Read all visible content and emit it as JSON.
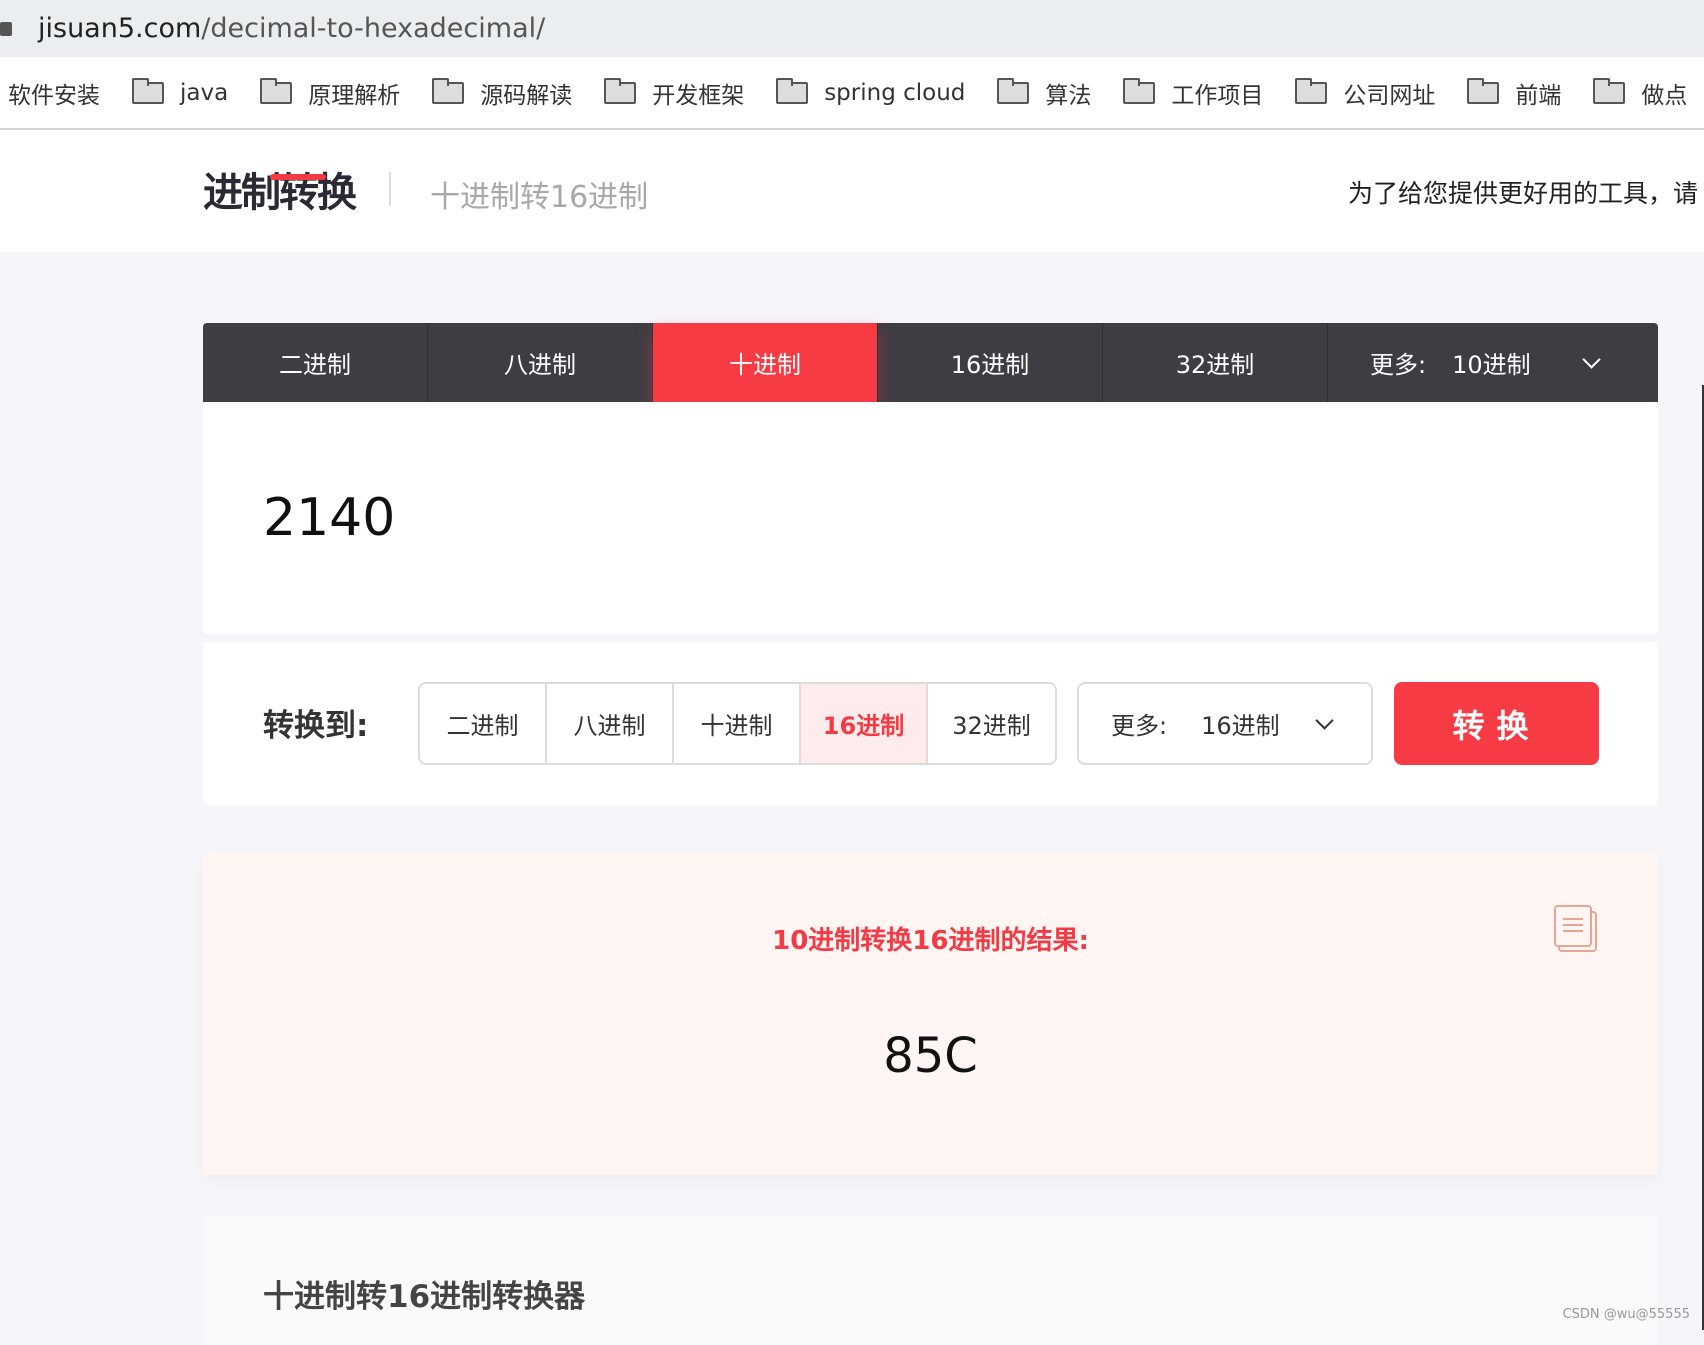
{
  "browser": {
    "url_host": "jisuan5.com",
    "url_path": "/decimal-to-hexadecimal/"
  },
  "bookmarks": [
    {
      "label": "软件安装",
      "folder": false
    },
    {
      "label": "java",
      "folder": true
    },
    {
      "label": "原理解析",
      "folder": true
    },
    {
      "label": "源码解读",
      "folder": true
    },
    {
      "label": "开发框架",
      "folder": true
    },
    {
      "label": "spring cloud",
      "folder": true
    },
    {
      "label": "算法",
      "folder": true
    },
    {
      "label": "工作项目",
      "folder": true
    },
    {
      "label": "公司网址",
      "folder": true
    },
    {
      "label": "前端",
      "folder": true
    },
    {
      "label": "做点",
      "folder": true
    }
  ],
  "header": {
    "logo": "进制转换",
    "subtitle": "十进制转16进制",
    "notice": "为了给您提供更好用的工具，请"
  },
  "from_tabs": {
    "items": [
      "二进制",
      "八进制",
      "十进制",
      "16进制",
      "32进制"
    ],
    "active": 2,
    "more_label": "更多:",
    "more_value": "10进制"
  },
  "input": {
    "value": "2140"
  },
  "convert": {
    "label": "转换到:",
    "options": [
      "二进制",
      "八进制",
      "十进制",
      "16进制",
      "32进制"
    ],
    "selected": 3,
    "more_label": "更多:",
    "more_value": "16进制",
    "button": "转换"
  },
  "result": {
    "title": "10进制转换16进制的结果:",
    "value": "85C"
  },
  "info": {
    "title": "十进制转16进制转换器"
  },
  "watermark": "CSDN @wu@55555",
  "colors": {
    "accent": "#f73b45",
    "tabbar": "#3e3d44",
    "result_bg": "#fff6f4"
  }
}
